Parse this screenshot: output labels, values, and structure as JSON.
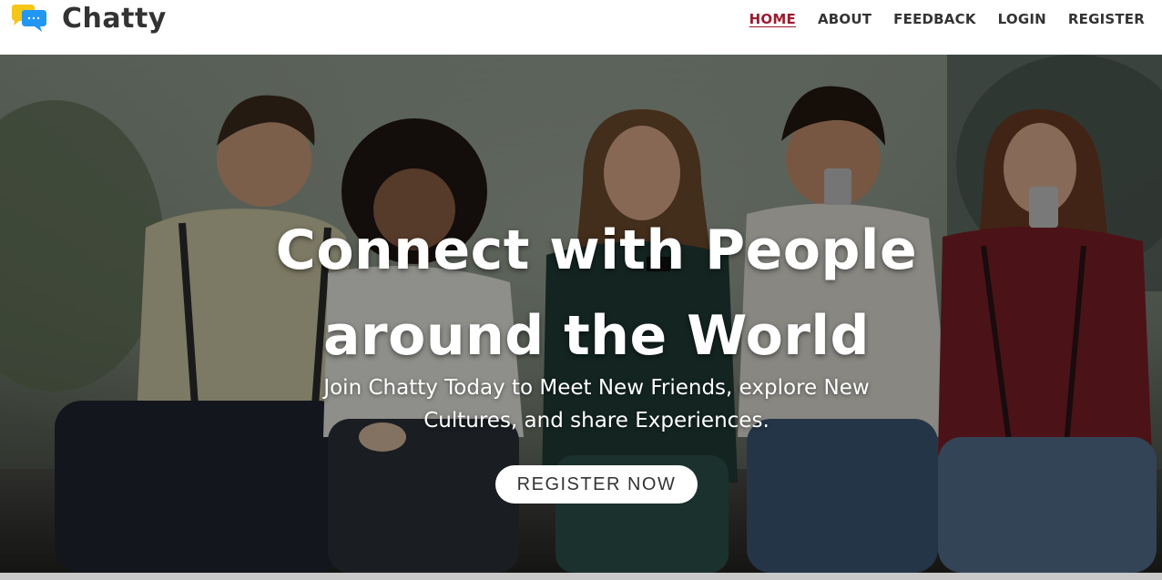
{
  "brand": {
    "name": "Chatty",
    "logo_icon": "chat-bubbles-icon",
    "logo_colors": {
      "back_bubble": "#f5c518",
      "front_bubble": "#2196f3"
    }
  },
  "nav": {
    "items": [
      {
        "label": "HOME",
        "active": true
      },
      {
        "label": "ABOUT",
        "active": false
      },
      {
        "label": "FEEDBACK",
        "active": false
      },
      {
        "label": "LOGIN",
        "active": false
      },
      {
        "label": "REGISTER",
        "active": false
      }
    ],
    "active_color": "#9b1b30",
    "text_color": "#333333"
  },
  "hero": {
    "title_line_1": "Connect with People",
    "title_line_2": "around the World",
    "subtitle_line_1": "Join Chatty Today to Meet New Friends, explore New",
    "subtitle_line_2": "Cultures, and share Experiences.",
    "cta_label": "REGISTER NOW",
    "background_image": "group-of-friends-using-smartphones-photo"
  }
}
